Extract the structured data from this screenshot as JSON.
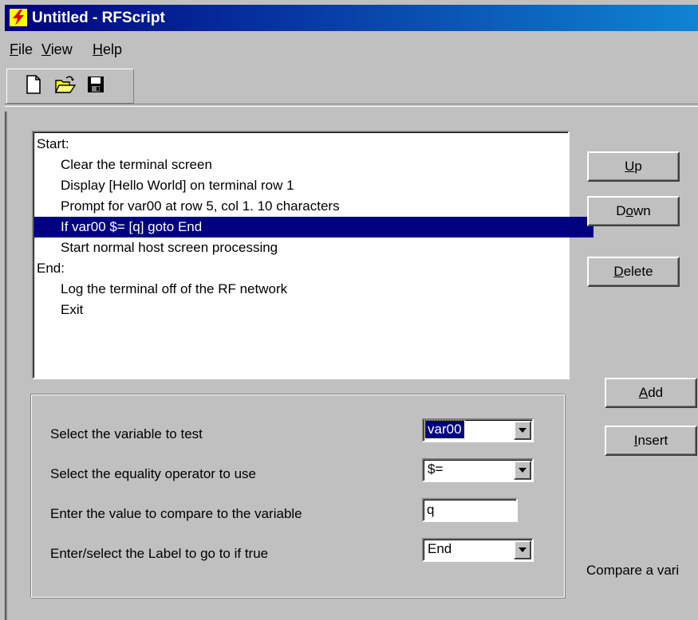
{
  "window": {
    "title": "Untitled - RFScript",
    "icon": "lightning-bolt-icon"
  },
  "menu": {
    "items": [
      {
        "label_key": "F",
        "label_rest": "ile"
      },
      {
        "label_key": "V",
        "label_rest": "iew"
      },
      {
        "label_key": "H",
        "label_rest": "elp"
      }
    ]
  },
  "toolbar": {
    "buttons": [
      "new-document-icon",
      "open-folder-icon",
      "save-disk-icon"
    ]
  },
  "script": {
    "rows": [
      {
        "text": "Start:"
      },
      {
        "text": "Clear the terminal screen"
      },
      {
        "text": "Display [Hello World] on terminal row 1"
      },
      {
        "text": "Prompt for var00 at row 5, col 1. 10 characters"
      },
      {
        "text": "If var00 $= [q] goto End",
        "selected": true
      },
      {
        "text": "Start normal host screen processing"
      },
      {
        "text": "End:"
      },
      {
        "text": "Log the terminal off of the RF network"
      },
      {
        "text": "Exit"
      }
    ]
  },
  "buttons": {
    "up": {
      "key": "U",
      "rest": "p"
    },
    "down": {
      "pre": "D",
      "key": "o",
      "rest": "wn"
    },
    "delete": {
      "key": "D",
      "rest": "elete"
    },
    "add": {
      "key": "A",
      "rest": "dd"
    },
    "insert": {
      "key": "I",
      "rest": "nsert"
    }
  },
  "params": {
    "variable_label": "Select the variable to test",
    "variable_value": "var00",
    "operator_label": "Select the equality operator to use",
    "operator_value": "$=",
    "compare_label": "Enter the value to compare to the variable",
    "compare_value": "q",
    "goto_label": "Enter/select the Label to go to if true",
    "goto_value": "End"
  },
  "status": {
    "text": "Compare a vari"
  },
  "colors": {
    "face": "#c0c0c0",
    "selection": "#000080",
    "title_start": "#000080",
    "title_end": "#1084d0"
  }
}
